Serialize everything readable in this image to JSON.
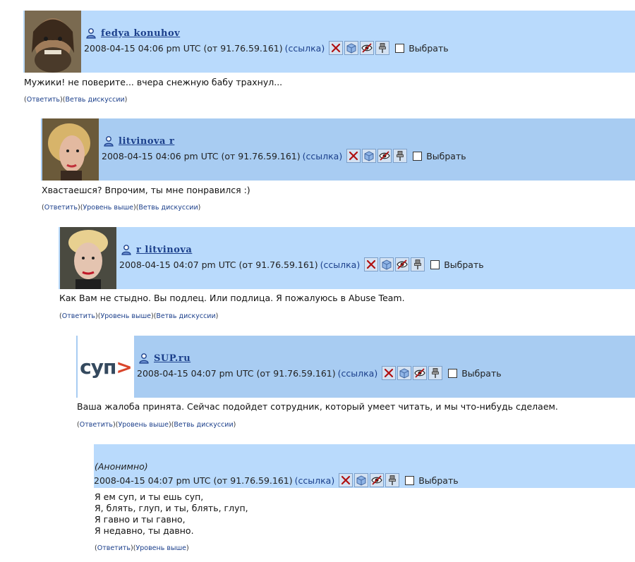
{
  "select_label": "Выбрать",
  "icons": {
    "user": "user-icon",
    "delete": "red-x-icon",
    "screen": "box-icon",
    "hide": "eye-hidden-icon",
    "pin": "pin-icon"
  },
  "comments": [
    {
      "username": "fedya konuhov",
      "time": "2008-04-15 04:06 pm UTC",
      "ip": "(от 91.76.59.161)",
      "link": "(ссылка)",
      "text": "Мужики! не поверите... вчера снежную бабу трахнул...",
      "actions": {
        "reply": "Ответить",
        "thread": "Ветвь дискуссии"
      }
    },
    {
      "username": "litvinova r",
      "time": "2008-04-15 04:06 pm UTC",
      "ip": "(от 91.76.59.161)",
      "link": "(ссылка)",
      "text": "Хвастаешся? Впрочим, ты мне понравился :)",
      "actions": {
        "reply": "Ответить",
        "parent": "Уровень выше",
        "thread": "Ветвь дискуссии"
      }
    },
    {
      "username": "r litvinova",
      "time": "2008-04-15 04:07 pm UTC",
      "ip": "(от 91.76.59.161)",
      "link": "(ссылка)",
      "text": "Как Вам не стыдно. Вы подлец. Или подлица. Я пожалуюсь в Abuse Team.",
      "actions": {
        "reply": "Ответить",
        "parent": "Уровень выше",
        "thread": "Ветвь дискуссии"
      }
    },
    {
      "username": "SUP.ru",
      "avatar_text": "суп",
      "time": "2008-04-15 04:07 pm UTC",
      "ip": "(от 91.76.59.161)",
      "link": "(ссылка)",
      "text": "Ваша жалоба принята. Сейчас подойдет сотрудник, который умеет читать, и мы что-нибудь сделаем.",
      "actions": {
        "reply": "Ответить",
        "parent": "Уровень выше",
        "thread": "Ветвь дискуссии"
      }
    },
    {
      "anon_label": "(Анонимно)",
      "time": "2008-04-15 04:07 pm UTC",
      "ip": "(от 91.76.59.161)",
      "link": "(ссылка)",
      "text": "Я ем суп, и ты ешь суп,\nЯ, блять, глуп, и ты, блять, глуп,\nЯ гавно и ты гавно,\nЯ недавно, ты давно.",
      "actions": {
        "reply": "Ответить",
        "parent": "Уровень выше"
      }
    }
  ]
}
